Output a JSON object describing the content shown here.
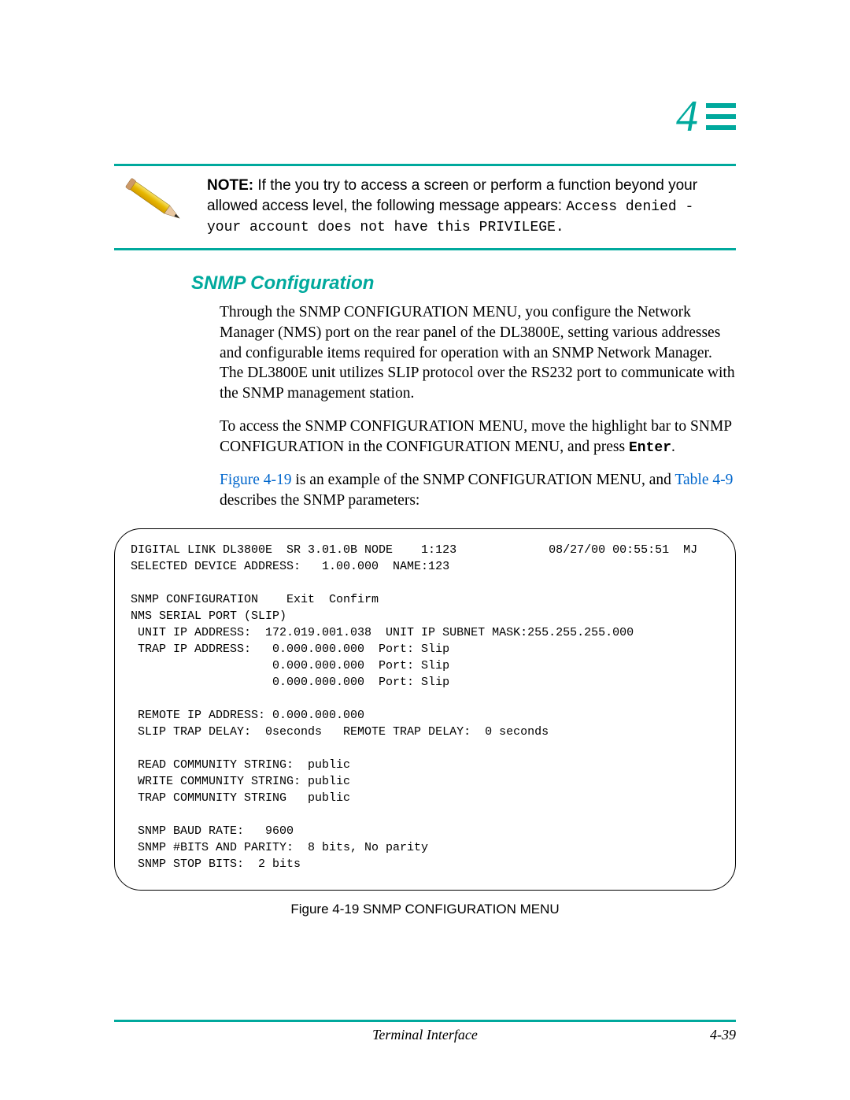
{
  "chapter": {
    "number": "4"
  },
  "note": {
    "label": "NOTE:",
    "body1": " If the you try to access a screen or perform a function beyond your allowed access level, the following message appears: ",
    "mono": "Access denied - your account does not have this PRIVILEGE.",
    "period": ""
  },
  "section": {
    "title": "SNMP Configuration"
  },
  "paragraphs": {
    "p1": "Through the SNMP CONFIGURATION MENU, you configure the Network Manager (NMS) port on the rear panel of the DL3800E, setting various addresses and configurable items required for operation with an SNMP Network Manager. The DL3800E unit utilizes SLIP protocol over the RS232 port to communicate with the SNMP management station.",
    "p2a": "To access the SNMP CONFIGURATION MENU, move the highlight bar to SNMP CONFIGURATION in the CONFIGURATION MENU, and press ",
    "p2_enter": "Enter",
    "p2b": ".",
    "p3a": "Figure 4-19",
    "p3b": " is an example of the SNMP CONFIGURATION MENU, and ",
    "p3c": "Table 4-9",
    "p3d": " describes the SNMP parameters:"
  },
  "terminal": {
    "line01": "DIGITAL LINK DL3800E  SR 3.01.0B NODE    1:123             08/27/00 00:55:51  MJ",
    "line02": "SELECTED DEVICE ADDRESS:   1.00.000  NAME:123",
    "blank1": "",
    "line03": "SNMP CONFIGURATION    Exit  Confirm",
    "line04": "NMS SERIAL PORT (SLIP)",
    "line05": " UNIT IP ADDRESS:  172.019.001.038  UNIT IP SUBNET MASK:255.255.255.000",
    "line06": " TRAP IP ADDRESS:   0.000.000.000  Port: Slip",
    "line07": "                    0.000.000.000  Port: Slip",
    "line08": "                    0.000.000.000  Port: Slip",
    "blank2": "",
    "line09": " REMOTE IP ADDRESS: 0.000.000.000",
    "line10": " SLIP TRAP DELAY:  0seconds   REMOTE TRAP DELAY:  0 seconds",
    "blank3": "",
    "line11": " READ COMMUNITY STRING:  public",
    "line12": " WRITE COMMUNITY STRING: public",
    "line13": " TRAP COMMUNITY STRING   public",
    "blank4": "",
    "line14": " SNMP BAUD RATE:   9600",
    "line15": " SNMP #BITS AND PARITY:  8 bits, No parity",
    "line16": " SNMP STOP BITS:  2 bits"
  },
  "figure": {
    "caption": "Figure 4-19  SNMP CONFIGURATION MENU"
  },
  "footer": {
    "title": "Terminal Interface",
    "page": "4-39"
  }
}
